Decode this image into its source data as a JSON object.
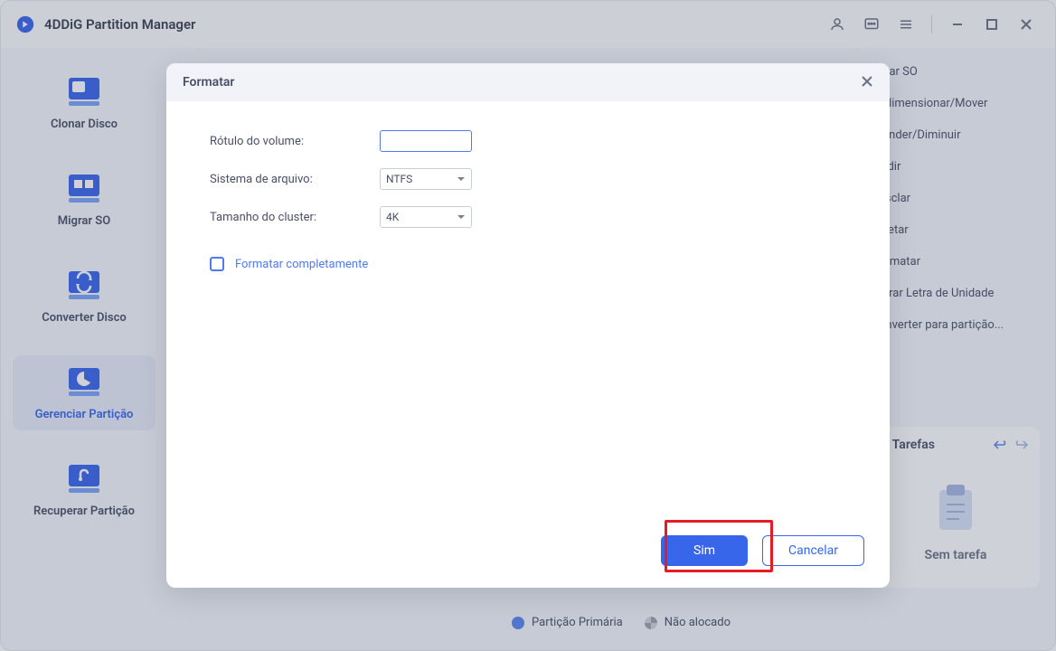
{
  "titlebar": {
    "app_name": "4DDiG Partition Manager"
  },
  "sidebar": {
    "items": [
      {
        "label": "Clonar Disco"
      },
      {
        "label": "Migrar SO"
      },
      {
        "label": "Converter Disco"
      },
      {
        "label": "Gerenciar Partição"
      },
      {
        "label": "Recuperar Partição"
      }
    ]
  },
  "right_ops": {
    "items": [
      "grar SO",
      "edimensionar/Mover",
      "tender/Diminuir",
      "vidir",
      "esclar",
      "eletar",
      "ormatar",
      "terar Letra de Unidade",
      "onverter para partição..."
    ]
  },
  "tasks": {
    "title": "e Tarefas",
    "empty_text": "Sem tarefa"
  },
  "legend": {
    "primary": "Partição Primária",
    "unallocated": "Não alocado"
  },
  "modal": {
    "title": "Formatar",
    "volume_label": "Rótulo do volume:",
    "filesystem_label": "Sistema de arquivo:",
    "filesystem_value": "NTFS",
    "cluster_label": "Tamanho do cluster:",
    "cluster_value": "4K",
    "format_complete": "Formatar completamente",
    "ok": "Sim",
    "cancel": "Cancelar"
  }
}
